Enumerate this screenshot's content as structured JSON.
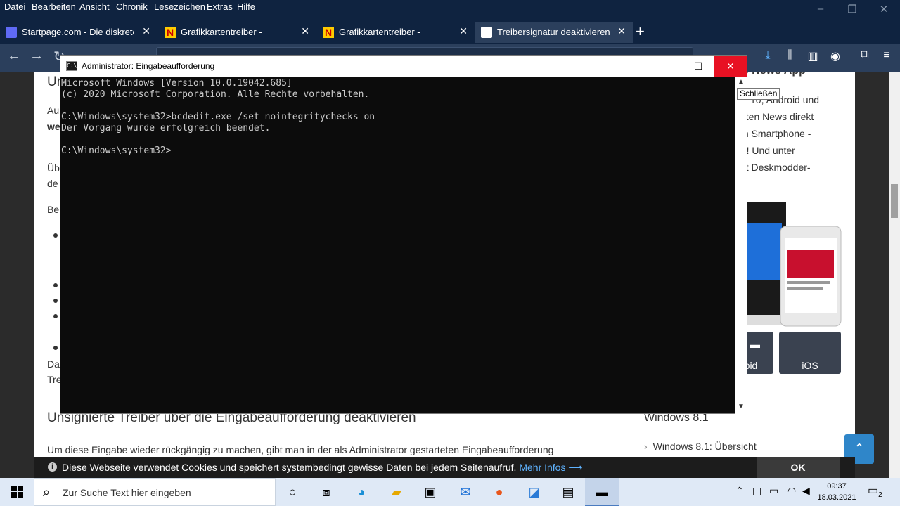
{
  "browser": {
    "menu": [
      "Datei",
      "Bearbeiten",
      "Ansicht",
      "Chronik",
      "Lesezeichen",
      "Extras",
      "Hilfe"
    ],
    "tabs": [
      {
        "title": "Startpage.com - Die diskreteste",
        "favicon": "startpage-icon"
      },
      {
        "title": "Grafikkartentreiber -",
        "favicon": "n-logo-icon"
      },
      {
        "title": "Grafikkartentreiber -",
        "favicon": "n-logo-icon"
      },
      {
        "title": "Treibersignatur deaktivieren Un",
        "favicon": "pen-icon",
        "active": true
      }
    ],
    "new_tab": "+"
  },
  "article": {
    "fragments": [
      "Un",
      "Au",
      "we",
      "Üb",
      "de",
      "Be",
      "Da",
      "Tre"
    ],
    "heading": "Unsignierte Treiber über die Eingabeaufforderung deaktivieren",
    "paragraph": "Um diese Eingabe wieder rückgängig zu machen, gibt man in der als Administrator gestarteten Eingabeaufforderung"
  },
  "sidebar": {
    "app_heading_fragment": "de News App",
    "lines": [
      "ws 10, Android und",
      "esten News direkt",
      "ein Smartphone -",
      "ng! Und unter",
      "mit Deskmodder-"
    ],
    "buttons": [
      {
        "label": "oid",
        "icon": "android-icon"
      },
      {
        "label": "iOS",
        "icon": "apple-icon"
      }
    ],
    "section_heading": "Windows 8.1",
    "link": "Windows 8.1: Übersicht"
  },
  "cookie": {
    "text": "Diese Webseite verwendet Cookies und speichert systembedingt gewisse Daten bei jedem Seitenaufruf.",
    "more": "Mehr Infos ⟶",
    "ok": "OK"
  },
  "cmd": {
    "title": "Administrator: Eingabeaufforderung",
    "lines": [
      "Microsoft Windows [Version 10.0.19042.685]",
      "(c) 2020 Microsoft Corporation. Alle Rechte vorbehalten.",
      "",
      "C:\\Windows\\system32>bcdedit.exe /set nointegritychecks on",
      "Der Vorgang wurde erfolgreich beendet.",
      "",
      "C:\\Windows\\system32>"
    ],
    "tooltip": "Schließen"
  },
  "taskbar": {
    "search_placeholder": "Zur Suche Text hier eingeben",
    "time": "09:37",
    "date": "18.03.2021",
    "notification_count": "2"
  }
}
